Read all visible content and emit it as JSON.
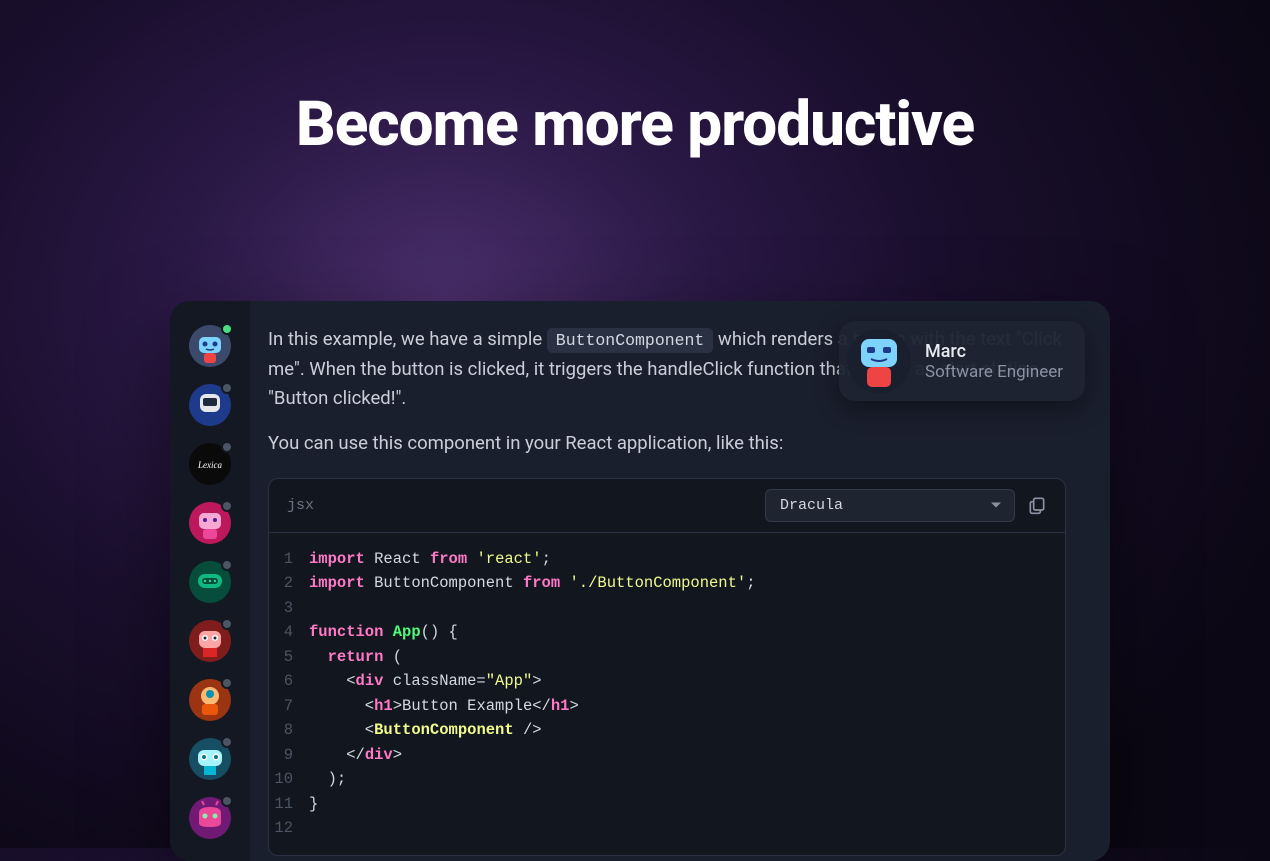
{
  "hero": {
    "title": "Become more productive"
  },
  "sidebar": {
    "avatars": [
      {
        "name": "avatar-1",
        "status": "online"
      },
      {
        "name": "avatar-2",
        "status": "offline"
      },
      {
        "name": "avatar-3",
        "status": "offline",
        "label": "Lexica"
      },
      {
        "name": "avatar-4",
        "status": "offline"
      },
      {
        "name": "avatar-5",
        "status": "offline"
      },
      {
        "name": "avatar-6",
        "status": "offline"
      },
      {
        "name": "avatar-7",
        "status": "offline"
      },
      {
        "name": "avatar-8",
        "status": "offline"
      },
      {
        "name": "avatar-9",
        "status": "offline"
      }
    ]
  },
  "content": {
    "para1_pre": "In this example, we have a simple ",
    "para1_code": "ButtonComponent",
    "para1_post": " which renders a button with the text \"Click me\". When the button is clicked, it triggers the handleClick function that shows an alert stating \"Button clicked!\".",
    "para2": "You can use this component in your React application, like this:"
  },
  "code": {
    "lang": "jsx",
    "theme": "Dracula",
    "lines": [
      {
        "n": 1,
        "tokens": [
          [
            "kw",
            "import"
          ],
          [
            "",
            " React "
          ],
          [
            "kw",
            "from"
          ],
          [
            "",
            " "
          ],
          [
            "str",
            "'react'"
          ],
          [
            "",
            ";"
          ]
        ]
      },
      {
        "n": 2,
        "tokens": [
          [
            "kw",
            "import"
          ],
          [
            "",
            " ButtonComponent "
          ],
          [
            "kw",
            "from"
          ],
          [
            "",
            " "
          ],
          [
            "str",
            "'./ButtonComponent'"
          ],
          [
            "",
            ";"
          ]
        ]
      },
      {
        "n": 3,
        "tokens": [
          [
            "",
            ""
          ]
        ]
      },
      {
        "n": 4,
        "tokens": [
          [
            "kw",
            "function"
          ],
          [
            "",
            " "
          ],
          [
            "fn",
            "App"
          ],
          [
            "",
            "() {"
          ]
        ]
      },
      {
        "n": 5,
        "tokens": [
          [
            "",
            "  "
          ],
          [
            "kw",
            "return"
          ],
          [
            "",
            " ("
          ]
        ]
      },
      {
        "n": 6,
        "tokens": [
          [
            "",
            "    <"
          ],
          [
            "tag",
            "div"
          ],
          [
            "",
            " className="
          ],
          [
            "str",
            "\"App\""
          ],
          [
            "",
            ">"
          ]
        ]
      },
      {
        "n": 7,
        "tokens": [
          [
            "",
            "      <"
          ],
          [
            "tag",
            "h1"
          ],
          [
            "",
            ">Button Example</"
          ],
          [
            "tag",
            "h1"
          ],
          [
            "",
            ">"
          ]
        ]
      },
      {
        "n": 8,
        "tokens": [
          [
            "",
            "      <"
          ],
          [
            "comp",
            "ButtonComponent"
          ],
          [
            "",
            " />"
          ]
        ]
      },
      {
        "n": 9,
        "tokens": [
          [
            "",
            "    </"
          ],
          [
            "tag",
            "div"
          ],
          [
            "",
            ">"
          ]
        ]
      },
      {
        "n": 10,
        "tokens": [
          [
            "",
            "  );"
          ]
        ]
      },
      {
        "n": 11,
        "tokens": [
          [
            "",
            "}"
          ]
        ]
      },
      {
        "n": 12,
        "tokens": [
          [
            "",
            ""
          ]
        ]
      }
    ]
  },
  "user": {
    "name": "Marc",
    "role": "Software Engineer"
  },
  "avatar_svgs": {
    "robot_blue": "<svg viewBox='0 0 42 42'><circle cx='21' cy='21' r='21' fill='#3b4a6b'/><rect x='10' y='12' width='22' height='16' rx='5' fill='#7dd3fc'/><circle cx='16' cy='19' r='2.5' fill='#1e3a8a'/><circle cx='26' cy='19' r='2.5' fill='#1e3a8a'/><path d='M17 24 Q21 26 25 24' stroke='#1e3a8a' stroke-width='1.5' fill='none'/><rect x='15' y='28' width='12' height='10' rx='3' fill='#ef4444'/></svg>",
    "robot_navy": "<svg viewBox='0 0 42 42'><circle cx='21' cy='21' r='21' fill='#1e3a8a'/><rect x='11' y='10' width='20' height='18' rx='6' fill='#e5e7eb'/><rect x='14' y='14' width='14' height='8' rx='2' fill='#1e293b'/><rect x='16' y='28' width='10' height='8' fill='#1e3a8a'/></svg>",
    "lexica": "<svg viewBox='0 0 42 42'><circle cx='21' cy='21' r='21' fill='#0a0a0a'/><text x='21' y='25' font-size='9' fill='#fff' text-anchor='middle' font-family='serif' font-style='italic'>Lexica</text></svg>",
    "robot_pink": "<svg viewBox='0 0 42 42'><circle cx='21' cy='21' r='21' fill='#be185d'/><rect x='10' y='11' width='22' height='16' rx='5' fill='#f9a8d4'/><circle cx='16' cy='18' r='2' fill='#4c1d95'/><circle cx='26' cy='18' r='2' fill='#4c1d95'/><rect x='14' y='27' width='14' height='10' rx='3' fill='#ec4899'/></svg>",
    "robot_green": "<svg viewBox='0 0 42 42'><circle cx='21' cy='21' r='21' fill='#064e3b'/><rect x='9' y='13' width='24' height='14' rx='7' fill='#10b981'/><rect x='13' y='17' width='16' height='6' rx='3' fill='#064e3b'/><circle cx='16' cy='20' r='1.2' fill='#34d399'/><circle cx='21' cy='20' r='1.2' fill='#34d399'/><circle cx='26' cy='20' r='1.2' fill='#34d399'/></svg>",
    "robot_red": "<svg viewBox='0 0 42 42'><circle cx='21' cy='21' r='21' fill='#7f1d1d'/><rect x='10' y='11' width='22' height='17' rx='6' fill='#fca5a5'/><circle cx='16' cy='18' r='3' fill='#fff'/><circle cx='26' cy='18' r='3' fill='#fff'/><circle cx='16' cy='18' r='1.5' fill='#1e293b'/><circle cx='26' cy='18' r='1.5' fill='#1e293b'/><rect x='14' y='28' width='14' height='9' fill='#dc2626'/></svg>",
    "robot_orange": "<svg viewBox='0 0 42 42'><circle cx='21' cy='21' r='21' fill='#9a3412'/><circle cx='21' cy='17' r='9' fill='#fdba74'/><circle cx='21' cy='15' r='4' fill='#0891b2'/><rect x='13' y='25' width='16' height='11' rx='3' fill='#ea580c'/></svg>",
    "robot_cyan": "<svg viewBox='0 0 42 42'><circle cx='21' cy='21' r='21' fill='#164e63'/><rect x='9' y='12' width='24' height='16' rx='6' fill='#a5f3fc'/><circle cx='15' cy='19' r='3.5' fill='#fff'/><circle cx='27' cy='19' r='3.5' fill='#fff'/><circle cx='15' cy='19' r='2' fill='#0e7490'/><circle cx='27' cy='19' r='2' fill='#0e7490'/><rect x='15' y='28' width='12' height='9' fill='#06b6d4'/></svg>",
    "robot_magenta": "<svg viewBox='0 0 42 42'><circle cx='21' cy='21' r='21' fill='#701a75'/><path d='M10 16 Q10 10 21 10 Q32 10 32 16 L32 26 Q32 30 21 30 Q10 30 10 26 Z' fill='#ec4899'/><circle cx='16' cy='19' r='2.5' fill='#86efac'/><circle cx='26' cy='19' r='2.5' fill='#86efac'/><path d='M15 8 L13 4 M27 8 L29 4' stroke='#ec4899' stroke-width='2'/></svg>",
    "user_robot": "<svg viewBox='0 0 64 64'><rect x='14' y='10' width='36' height='28' rx='8' fill='#7dd3fc'/><rect x='20' y='18' width='8' height='6' rx='2' fill='#1e3a8a'/><rect x='36' y='18' width='8' height='6' rx='2' fill='#1e3a8a'/><path d='M24 30 Q32 34 40 30' stroke='#1e3a8a' stroke-width='2' fill='none'/><rect x='20' y='38' width='24' height='20' rx='5' fill='#ef4444'/></svg>"
  }
}
